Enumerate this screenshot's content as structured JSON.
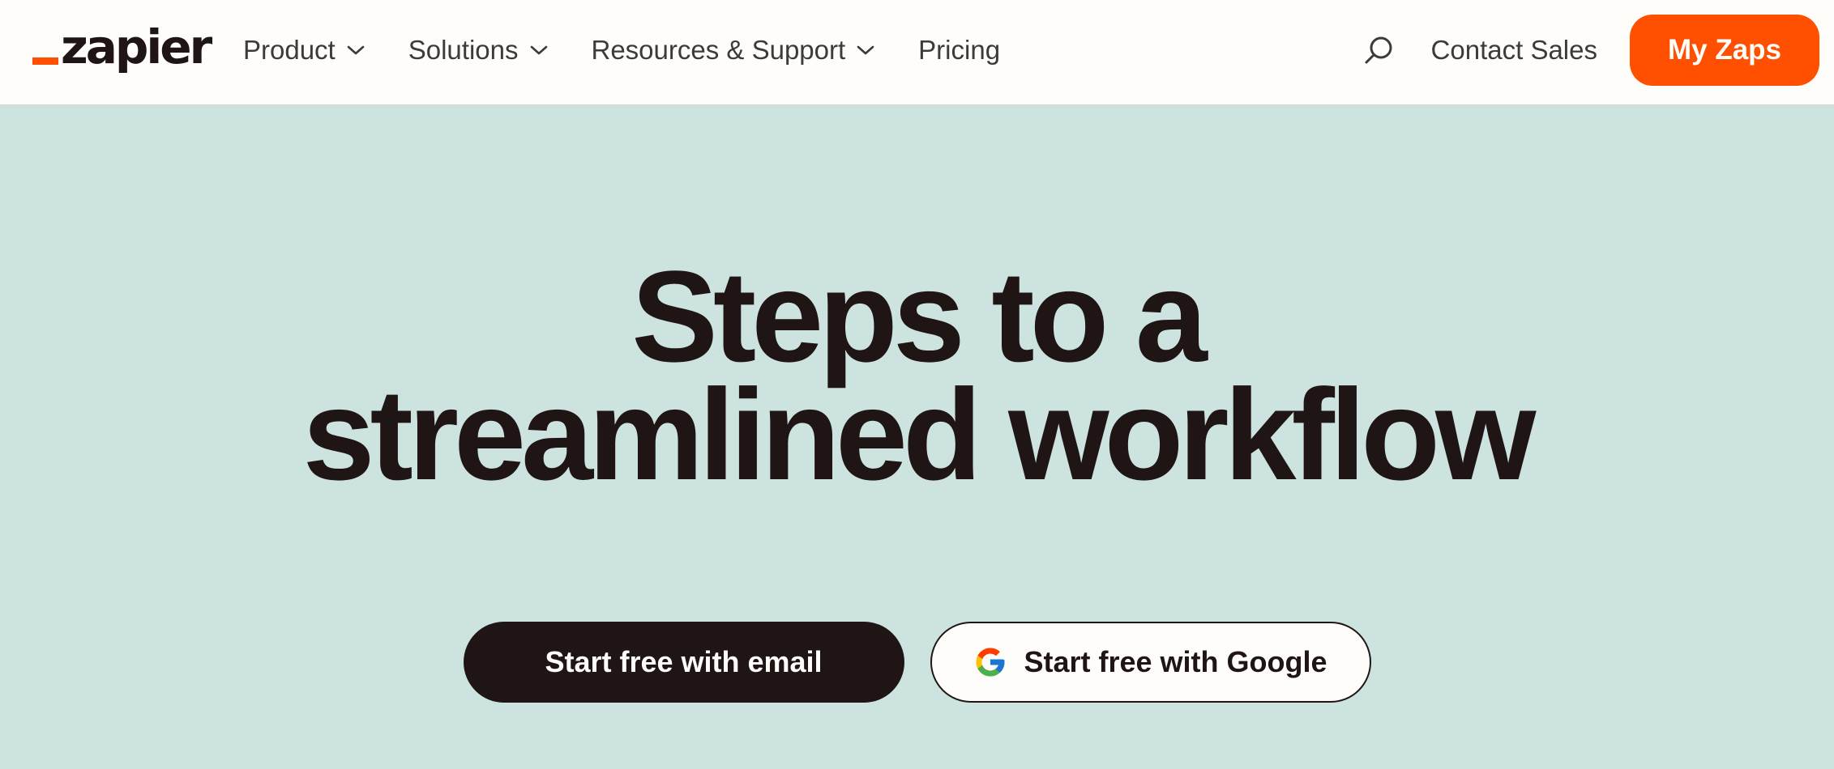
{
  "brand": {
    "logo_text": "zapier",
    "accent_color": "#ff4f00"
  },
  "nav": {
    "items": [
      {
        "label": "Product",
        "has_dropdown": true
      },
      {
        "label": "Solutions",
        "has_dropdown": true
      },
      {
        "label": "Resources & Support",
        "has_dropdown": true
      },
      {
        "label": "Pricing",
        "has_dropdown": false
      }
    ],
    "search_icon": "search-icon",
    "contact_label": "Contact Sales",
    "cta_label": "My Zaps"
  },
  "hero": {
    "title_line1": "Steps to a",
    "title_line2": "streamlined workflow",
    "background_color": "#cde3e0",
    "buttons": {
      "email_label": "Start free with email",
      "google_label": "Start free with Google",
      "google_icon": "google-icon"
    }
  }
}
